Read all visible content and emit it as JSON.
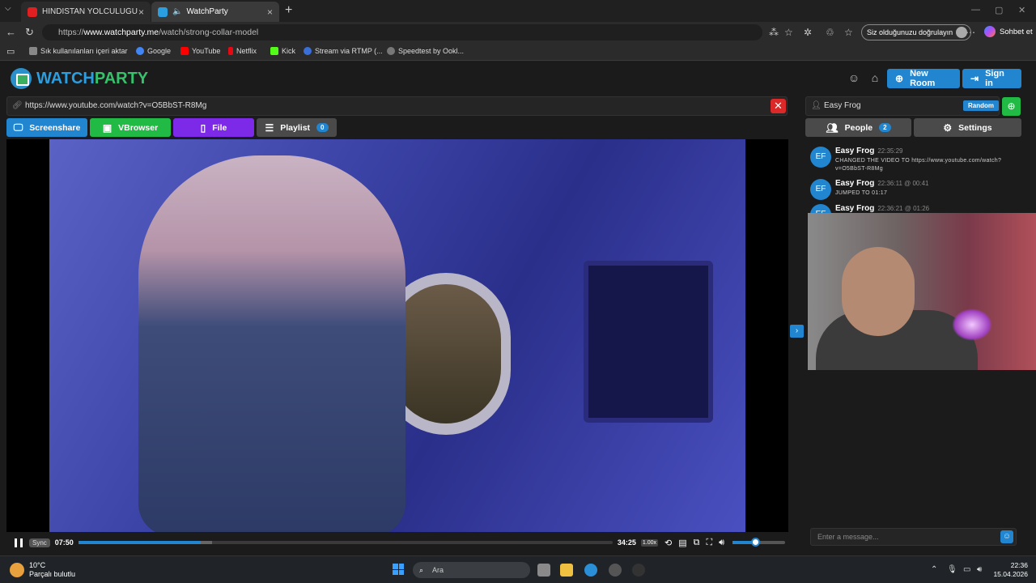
{
  "browser": {
    "tabs": [
      {
        "title": "HİNDİSTAN YOLCULUĞU VE HİNDİ",
        "favicon_color": "#e02020"
      },
      {
        "title": "WatchParty",
        "favicon_color": "#2b9ee0"
      }
    ],
    "url_prefix": "https://",
    "url_host": "www.watchparty.me",
    "url_path": "/watch/strong-collar-model",
    "verify_label": "Siz olduğunuzu doğrulayın",
    "chat_label": "Sohbet et",
    "bookmarks": [
      {
        "label": "Sık kullanılanları içeri aktar",
        "color": "#888888"
      },
      {
        "label": "Google",
        "color": "#4285f4"
      },
      {
        "label": "YouTube",
        "color": "#ff0000"
      },
      {
        "label": "Netflix",
        "color": "#e50914"
      },
      {
        "label": "Kick",
        "color": "#53fc18"
      },
      {
        "label": "Stream via RTMP (...",
        "color": "#3a6fd8"
      },
      {
        "label": "Speedtest by Ookl...",
        "color": "#777777"
      }
    ]
  },
  "app": {
    "logo_part1": "WATCH",
    "logo_part2": "PARTY",
    "new_room_label": "New Room",
    "sign_in_label": "Sign in",
    "video_url": "https://www.youtube.com/watch?v=O5BbST-R8Mg",
    "sources": [
      {
        "label": "Screenshare",
        "color": "#2185d0"
      },
      {
        "label": "VBrowser",
        "color": "#21ba45"
      },
      {
        "label": "File",
        "color": "#7d2ae8"
      },
      {
        "label": "Playlist",
        "color": "#4a4a4a",
        "count": "0"
      }
    ],
    "player": {
      "sync_label": "Sync",
      "current_time": "07:50",
      "duration": "34:25",
      "progress_fraction": 0.229,
      "speed": "1.00x",
      "volume_fraction": 0.43
    },
    "user_name": "Easy Frog",
    "random_label": "Random",
    "people_label": "People",
    "people_count": "2",
    "settings_label": "Settings",
    "messages": [
      {
        "initials": "EF",
        "name": "Easy Frog",
        "time": "22:35:29",
        "text": "CHANGED THE VIDEO TO https://www.youtube.com/watch?v=O5BbST-R8Mg"
      },
      {
        "initials": "EF",
        "name": "Easy Frog",
        "time": "22:36:11 @ 00:41",
        "text": "JUMPED TO 01:17"
      },
      {
        "initials": "EF",
        "name": "Easy Frog",
        "time": "22:36:21 @ 01:26",
        "text": ""
      }
    ],
    "message_placeholder": "Enter a message..."
  },
  "taskbar": {
    "temperature": "10°C",
    "weather": "Parçalı bulutlu",
    "search_placeholder": "Ara",
    "time": "22:36",
    "date": "15.04.2026"
  }
}
